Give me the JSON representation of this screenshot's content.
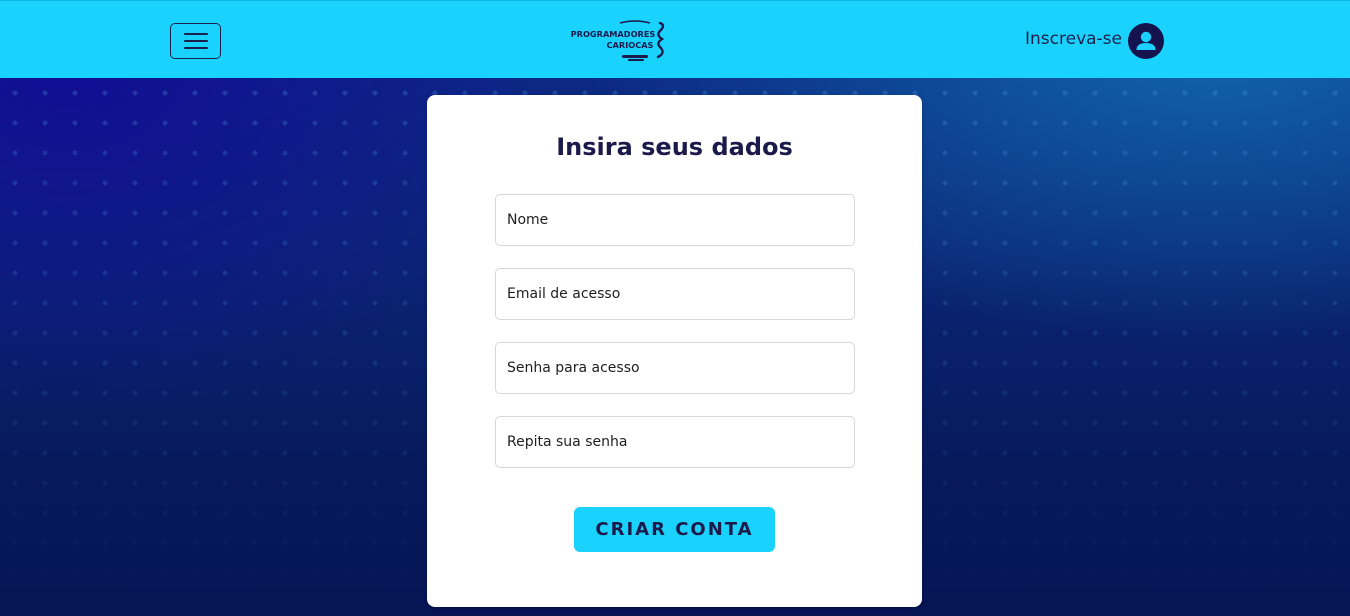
{
  "header": {
    "logo_line1": "PROGRAMADORES",
    "logo_line2": "CARIOCAS",
    "signup_label": "Inscreva-se",
    "menu_icon": "hamburger-menu-icon",
    "avatar_icon": "user-icon"
  },
  "form": {
    "title": "Insira seus dados",
    "fields": [
      {
        "placeholder": "Nome",
        "value": ""
      },
      {
        "placeholder": "Email de acesso",
        "value": ""
      },
      {
        "placeholder": "Senha para acesso",
        "value": ""
      },
      {
        "placeholder": "Repita sua senha",
        "value": ""
      }
    ],
    "submit_label": "CRIAR CONTA"
  },
  "colors": {
    "header_bg": "#19d3fe",
    "accent": "#19d3fe",
    "text_dark": "#1b1a4a",
    "avatar_bg": "#15134e",
    "card_bg": "#ffffff"
  }
}
